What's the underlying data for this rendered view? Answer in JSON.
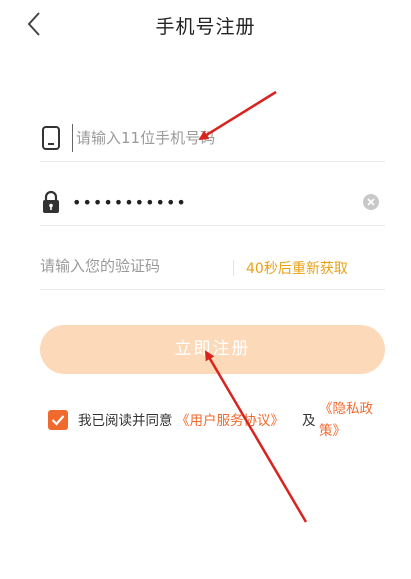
{
  "header": {
    "title": "手机号注册",
    "back_icon": "chevron-left-icon"
  },
  "form": {
    "phone": {
      "icon": "phone-icon",
      "placeholder": "请输入11位手机号码",
      "value": ""
    },
    "password": {
      "icon": "lock-icon",
      "value": "•••••••••••",
      "clear_icon": "clear-icon"
    },
    "code": {
      "placeholder": "请输入您的验证码",
      "value": "",
      "resend_label": "40秒后重新获取"
    },
    "submit_label": "立即注册"
  },
  "agreement": {
    "checked": true,
    "prefix": "我已阅读并同意",
    "service_link": "《用户服务协议》",
    "conjunction": "及",
    "privacy_link_part1": "《隐私政",
    "privacy_link_part2": "策》"
  },
  "colors": {
    "accent": "#f06a2f",
    "submit_bg": "#fcd9b8",
    "countdown": "#e8a21a",
    "annotation_arrow": "#d9231e"
  }
}
